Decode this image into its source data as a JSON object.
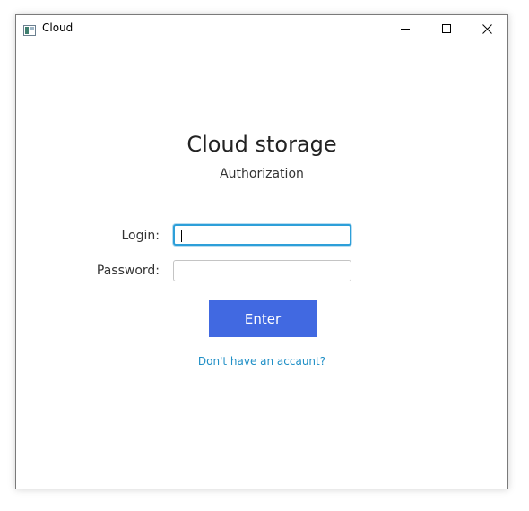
{
  "window": {
    "title": "Cloud"
  },
  "header": {
    "title": "Cloud storage",
    "subtitle": "Authorization"
  },
  "form": {
    "login_label": "Login:",
    "login_value": "",
    "password_label": "Password:",
    "password_value": "",
    "submit_label": "Enter",
    "signup_link": "Don't have an accaunt?"
  },
  "icons": {
    "app": "app-window-icon",
    "minimize": "minimize-icon",
    "maximize": "maximize-icon",
    "close": "close-icon"
  },
  "colors": {
    "accent_button": "#4169e1",
    "focus_border": "#2d9fd9",
    "link": "#1f8fc6"
  }
}
